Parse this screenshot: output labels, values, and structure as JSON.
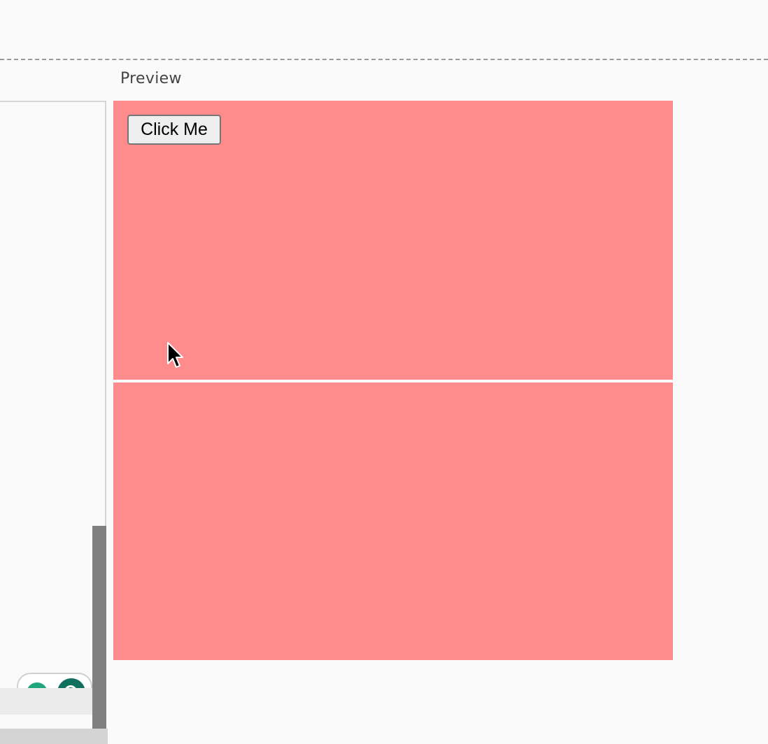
{
  "preview": {
    "label": "Preview",
    "button_label": "Click Me",
    "block_color": "#ff8c8c"
  },
  "icons": {
    "cursor": "mouse-pointer-icon",
    "bubble_left": "assistant-icon",
    "bubble_right": "chatgpt-icon"
  }
}
